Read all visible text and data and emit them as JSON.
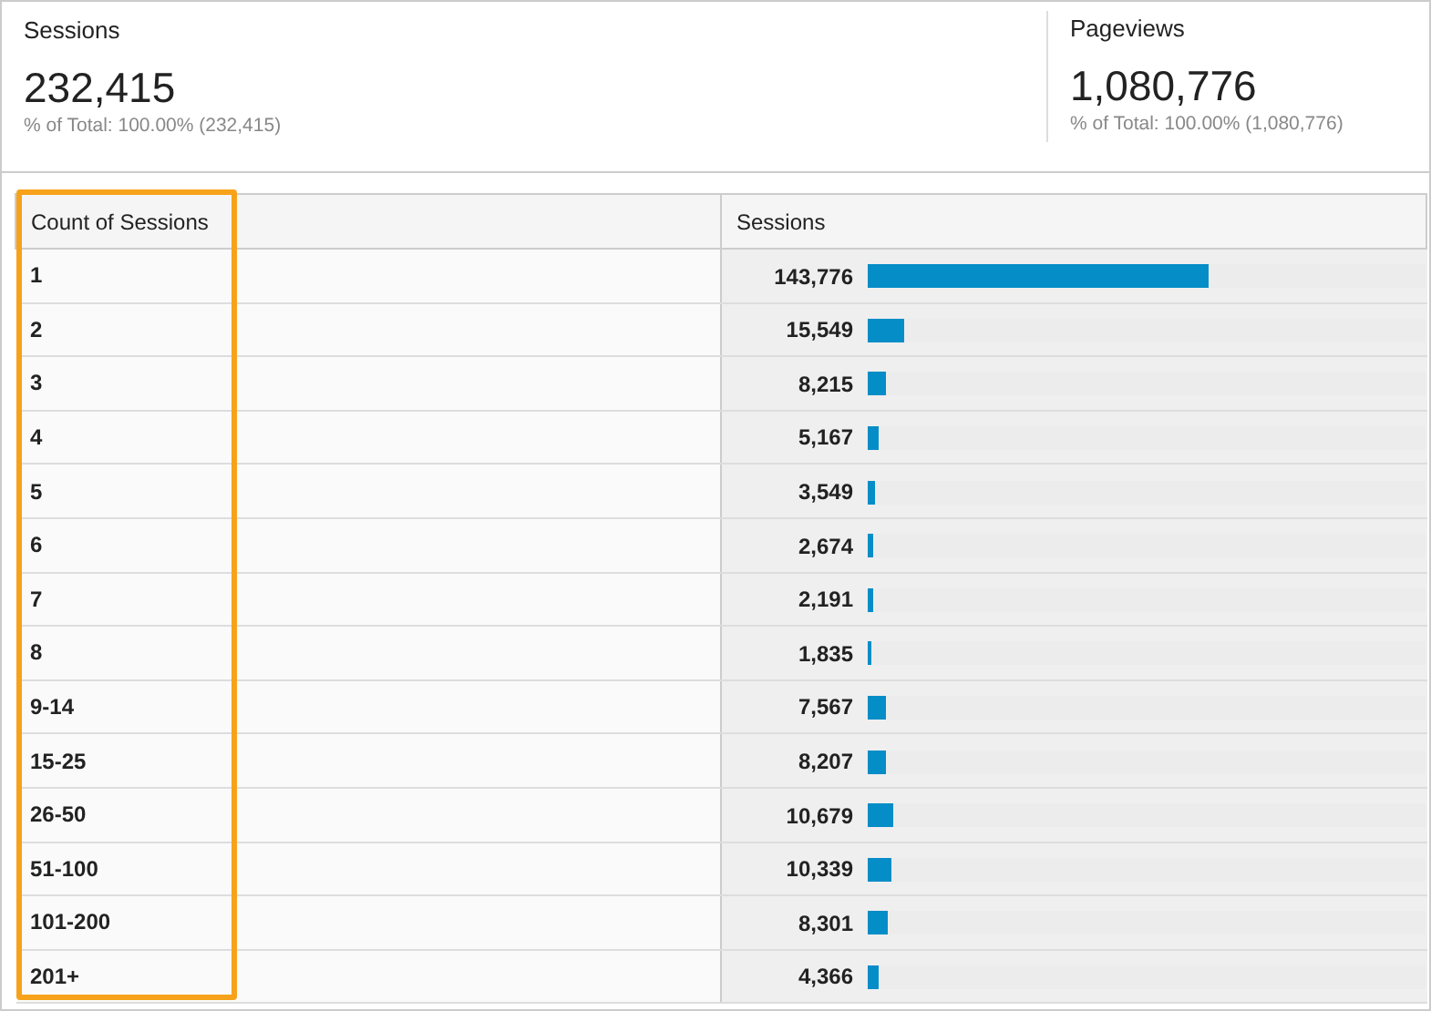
{
  "summary": [
    {
      "label": "Sessions",
      "value": "232,415",
      "note": "% of Total: 100.00% (232,415)"
    },
    {
      "label": "Pageviews",
      "value": "1,080,776",
      "note": "% of Total: 100.00% (1,080,776)"
    }
  ],
  "table": {
    "columns": [
      {
        "label": "Count of Sessions",
        "highlighted": true
      },
      {
        "label": "Sessions",
        "highlighted": false
      }
    ],
    "rows": [
      {
        "count": "1",
        "sessions": "143,776",
        "level": 0.61
      },
      {
        "count": "2",
        "sessions": "15,549",
        "level": 0.066
      },
      {
        "count": "3",
        "sessions": "8,215",
        "level": 0.034
      },
      {
        "count": "4",
        "sessions": "5,167",
        "level": 0.021
      },
      {
        "count": "5",
        "sessions": "3,549",
        "level": 0.014
      },
      {
        "count": "6",
        "sessions": "2,674",
        "level": 0.011
      },
      {
        "count": "7",
        "sessions": "2,191",
        "level": 0.009
      },
      {
        "count": "8",
        "sessions": "1,835",
        "level": 0.008
      },
      {
        "count": "9-14",
        "sessions": "7,567",
        "level": 0.032
      },
      {
        "count": "15-25",
        "sessions": "8,207",
        "level": 0.034
      },
      {
        "count": "26-50",
        "sessions": "10,679",
        "level": 0.045
      },
      {
        "count": "51-100",
        "sessions": "10,339",
        "level": 0.043
      },
      {
        "count": "101-200",
        "sessions": "8,301",
        "level": 0.035
      },
      {
        "count": "201+",
        "sessions": "4,366",
        "level": 0.018
      }
    ]
  }
}
